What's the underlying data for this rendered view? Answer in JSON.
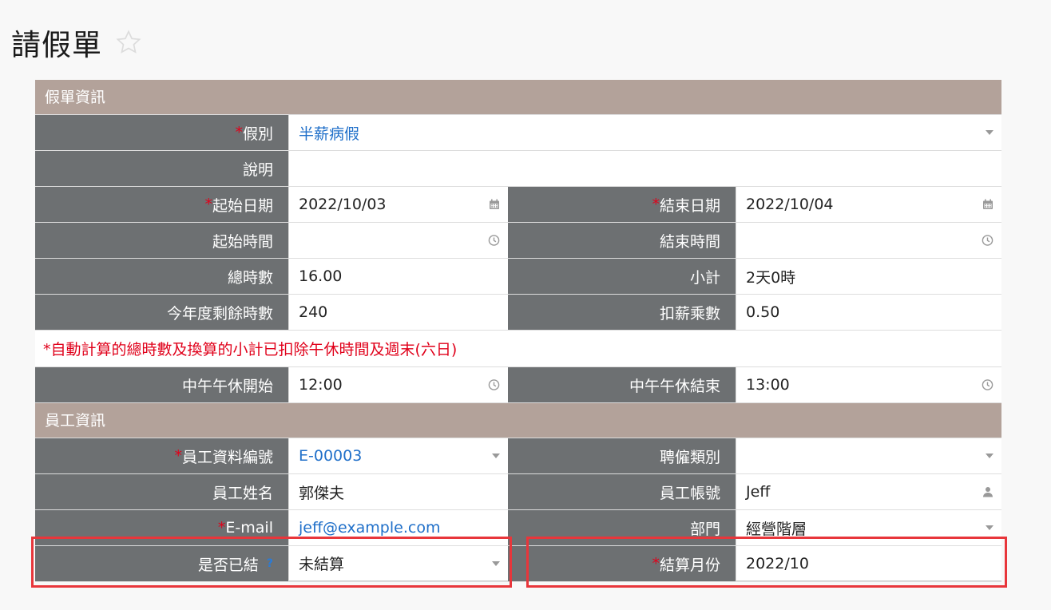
{
  "page": {
    "title": "請假單"
  },
  "sections": {
    "leave_info": "假單資訊",
    "employee_info": "員工資訊"
  },
  "fields": {
    "leave_type": {
      "label": "假別",
      "value": "半薪病假"
    },
    "description": {
      "label": "說明",
      "value": ""
    },
    "start_date": {
      "label": "起始日期",
      "value": "2022/10/03"
    },
    "end_date": {
      "label": "結束日期",
      "value": "2022/10/04"
    },
    "start_time": {
      "label": "起始時間",
      "value": ""
    },
    "end_time": {
      "label": "結束時間",
      "value": ""
    },
    "total_hours": {
      "label": "總時數",
      "value": "16.00"
    },
    "subtotal": {
      "label": "小計",
      "value": "2天0時"
    },
    "remaining_hours": {
      "label": "今年度剩餘時數",
      "value": "240"
    },
    "deduction_rate": {
      "label": "扣薪乘數",
      "value": "0.50"
    },
    "lunch_start": {
      "label": "中午午休開始",
      "value": "12:00"
    },
    "lunch_end": {
      "label": "中午午休結束",
      "value": "13:00"
    },
    "employee_id": {
      "label": "員工資料編號",
      "value": "E-00003"
    },
    "employment_type": {
      "label": "聘僱類別",
      "value": ""
    },
    "employee_name": {
      "label": "員工姓名",
      "value": "郭傑夫"
    },
    "employee_account": {
      "label": "員工帳號",
      "value": "Jeff"
    },
    "email": {
      "label": "E-mail",
      "value": "jeff@example.com"
    },
    "department": {
      "label": "部門",
      "value": "經營階層"
    },
    "settled": {
      "label": "是否已結",
      "value": "未結算",
      "help": "?"
    },
    "settle_month": {
      "label": "結算月份",
      "value": "2022/10"
    }
  },
  "required_mark": "*",
  "note": "*自動計算的總時數及換算的小計已扣除午休時間及週末(六日)",
  "colors": {
    "section_bg": "#b3a29a",
    "label_bg": "#6d7072",
    "required": "#e0001a",
    "link": "#1f6fc9",
    "highlight": "#e8363b"
  }
}
